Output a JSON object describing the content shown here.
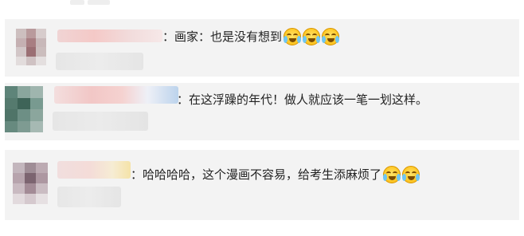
{
  "comments": [
    {
      "username_hidden": true,
      "separator": "：",
      "text": "画家：也是没有想到",
      "emoji_count": 3,
      "emoji": "laugh-cry-emoji"
    },
    {
      "username_hidden": true,
      "separator": "：",
      "text": "在这浮躁的年代！做人就应该一笔一划这样。",
      "emoji_count": 0
    },
    {
      "username_hidden": true,
      "separator": "：",
      "text": "哈哈哈哈，这个漫画不容易，给考生添麻烦了",
      "emoji_count": 2,
      "emoji": "laugh-cry-emoji"
    }
  ],
  "colors": {
    "card_background": "#f3f3f3",
    "text": "#222222",
    "name_blur_pink": "#f2c6c6",
    "name_blur_blue": "#bcd6ef",
    "name_blur_yellow": "#f7e9b8"
  }
}
